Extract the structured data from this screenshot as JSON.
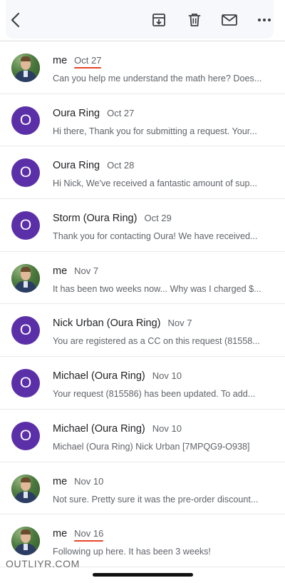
{
  "toolbar": {
    "back_icon": "chevron-left-icon",
    "archive_icon": "archive-icon",
    "delete_icon": "trash-icon",
    "mark_unread_icon": "envelope-icon",
    "more_icon": "more-horizontal-icon"
  },
  "messages": [
    {
      "sender": "me",
      "date": "Oct 27",
      "snippet": "Can you help me understand the math here? Does...",
      "avatar": "photo",
      "highlighted": true
    },
    {
      "sender": "Oura Ring",
      "date": "Oct 27",
      "snippet": "Hi there, Thank you for submitting a request. Your...",
      "avatar": "O",
      "highlighted": false
    },
    {
      "sender": "Oura Ring",
      "date": "Oct 28",
      "snippet": "Hi Nick, We've received a fantastic amount of sup...",
      "avatar": "O",
      "highlighted": false
    },
    {
      "sender": "Storm (Oura Ring)",
      "date": "Oct 29",
      "snippet": "Thank you for contacting Oura! We have received...",
      "avatar": "O",
      "highlighted": false
    },
    {
      "sender": "me",
      "date": "Nov 7",
      "snippet": "It has been two weeks now... Why was I charged $...",
      "avatar": "photo",
      "highlighted": false
    },
    {
      "sender": "Nick Urban (Oura Ring)",
      "date": "Nov 7",
      "snippet": "You are registered as a CC on this request (81558...",
      "avatar": "O",
      "highlighted": false
    },
    {
      "sender": "Michael (Oura Ring)",
      "date": "Nov 10",
      "snippet": "Your request (815586) has been updated. To add...",
      "avatar": "O",
      "highlighted": false
    },
    {
      "sender": "Michael (Oura Ring)",
      "date": "Nov 10",
      "snippet": "Michael (Oura Ring) Nick Urban [7MPQG9-O938]",
      "avatar": "O",
      "highlighted": false
    },
    {
      "sender": "me",
      "date": "Nov 10",
      "snippet": "Not sure. Pretty sure it was the pre-order discount...",
      "avatar": "photo",
      "highlighted": false
    },
    {
      "sender": "me",
      "date": "Nov 16",
      "snippet": "Following up here. It has been 3 weeks!",
      "avatar": "photo",
      "highlighted": true
    }
  ],
  "watermark": "OUTLIYR.COM",
  "colors": {
    "avatar_purple": "#5b2fa8",
    "underline_red": "#e8452c",
    "snippet_gray": "#5f6368"
  }
}
